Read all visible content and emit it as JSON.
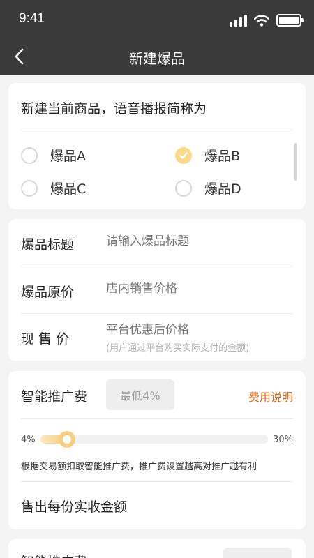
{
  "status_bar": {
    "time": "9:41"
  },
  "nav": {
    "title": "新建爆品"
  },
  "voice_section": {
    "title": "新建当前商品，语音播报简称为",
    "options": [
      {
        "label": "爆品A",
        "checked": false
      },
      {
        "label": "爆品B",
        "checked": true
      },
      {
        "label": "爆品C",
        "checked": false
      },
      {
        "label": "爆品D",
        "checked": false
      }
    ]
  },
  "form": {
    "title_label": "爆品标题",
    "title_placeholder": "请输入爆品标题",
    "original_price_label": "爆品原价",
    "original_price_placeholder": "店内销售价格",
    "current_price_label": "现 售 价",
    "current_price_placeholder": "平台优惠后价格",
    "current_price_hint": "(用户通过平台购买实际支付的金额)"
  },
  "promotion": {
    "label": "智能推广费",
    "fee_value": "最低4%",
    "explain_link": "费用说明",
    "slider": {
      "min_label": "4%",
      "max_label": "30%",
      "min": 4,
      "max": 30,
      "value": 7
    },
    "hint": "根据交易额扣取智能推广费，推广费设置越高对推广越有利",
    "receive_label": "售出每份实收金额"
  },
  "next_section": {
    "label": "智能推广费"
  },
  "colors": {
    "header_bg": "#3a3a3a",
    "accent": "#f5cc7a",
    "link": "#e0691a"
  }
}
